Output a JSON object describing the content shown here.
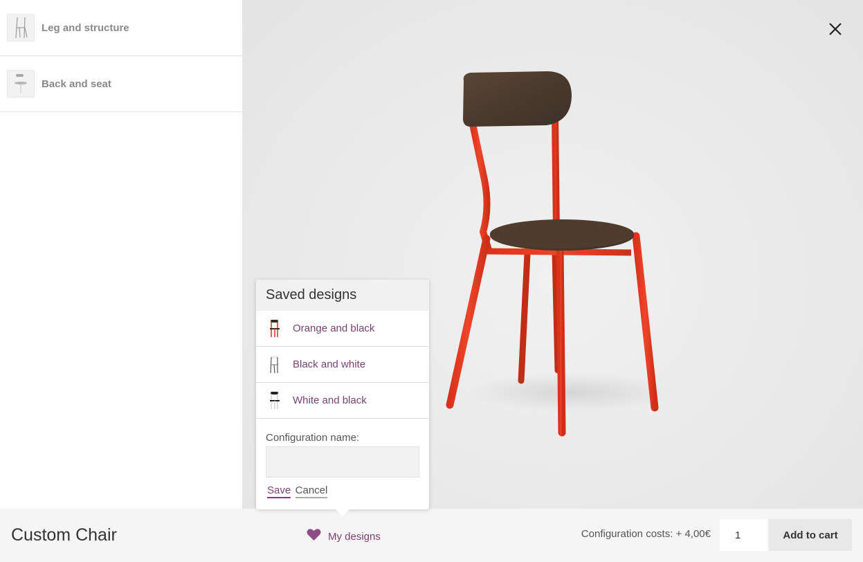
{
  "sidebar": {
    "layers": [
      {
        "label": "Leg and structure",
        "icon": "chair-structure-icon"
      },
      {
        "label": "Back and seat",
        "icon": "chair-back-seat-icon"
      }
    ]
  },
  "viewer": {
    "close_icon": "close-icon",
    "chair_colors": {
      "frame": "#e8391f",
      "wood": "#4f3d2f"
    }
  },
  "popup": {
    "title": "Saved designs",
    "designs": [
      {
        "label": "Orange and black",
        "icon": "chair-orange-black-icon"
      },
      {
        "label": "Black and white",
        "icon": "chair-black-white-icon"
      },
      {
        "label": "White and black",
        "icon": "chair-white-black-icon"
      }
    ],
    "form": {
      "label": "Configuration name:",
      "value": "",
      "placeholder": "",
      "save_label": "Save",
      "cancel_label": "Cancel"
    }
  },
  "footer": {
    "product_name": "Custom Chair",
    "my_designs_label": "My designs",
    "my_designs_icon": "heart-icon",
    "config_cost": "Configuration costs: + 4,00€",
    "quantity": "1",
    "add_to_cart_label": "Add to cart"
  },
  "colors": {
    "accent": "#7c3f75",
    "panel": "#ffffff",
    "viewer_bg": "#ececec",
    "footer_bg": "#f5f5f5"
  }
}
